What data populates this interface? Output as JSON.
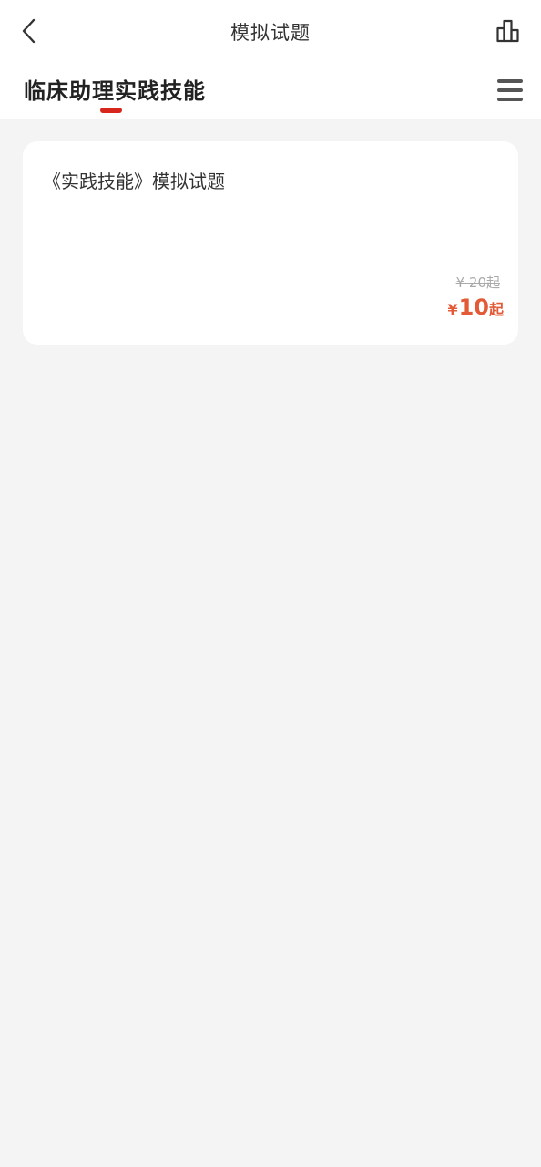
{
  "header": {
    "title": "模拟试题",
    "back_icon": "chevron-left-icon",
    "stats_icon": "bar-chart-icon"
  },
  "tabs": {
    "active_label": "临床助理实践技能",
    "menu_icon": "hamburger-menu-icon",
    "indicator_color": "#d7261b"
  },
  "items": [
    {
      "title": "《实践技能》模拟试题",
      "original_price": "¥ 20起",
      "price_currency": "¥",
      "price_value": "10",
      "price_suffix": "起",
      "price_color": "#e35a37"
    }
  ]
}
